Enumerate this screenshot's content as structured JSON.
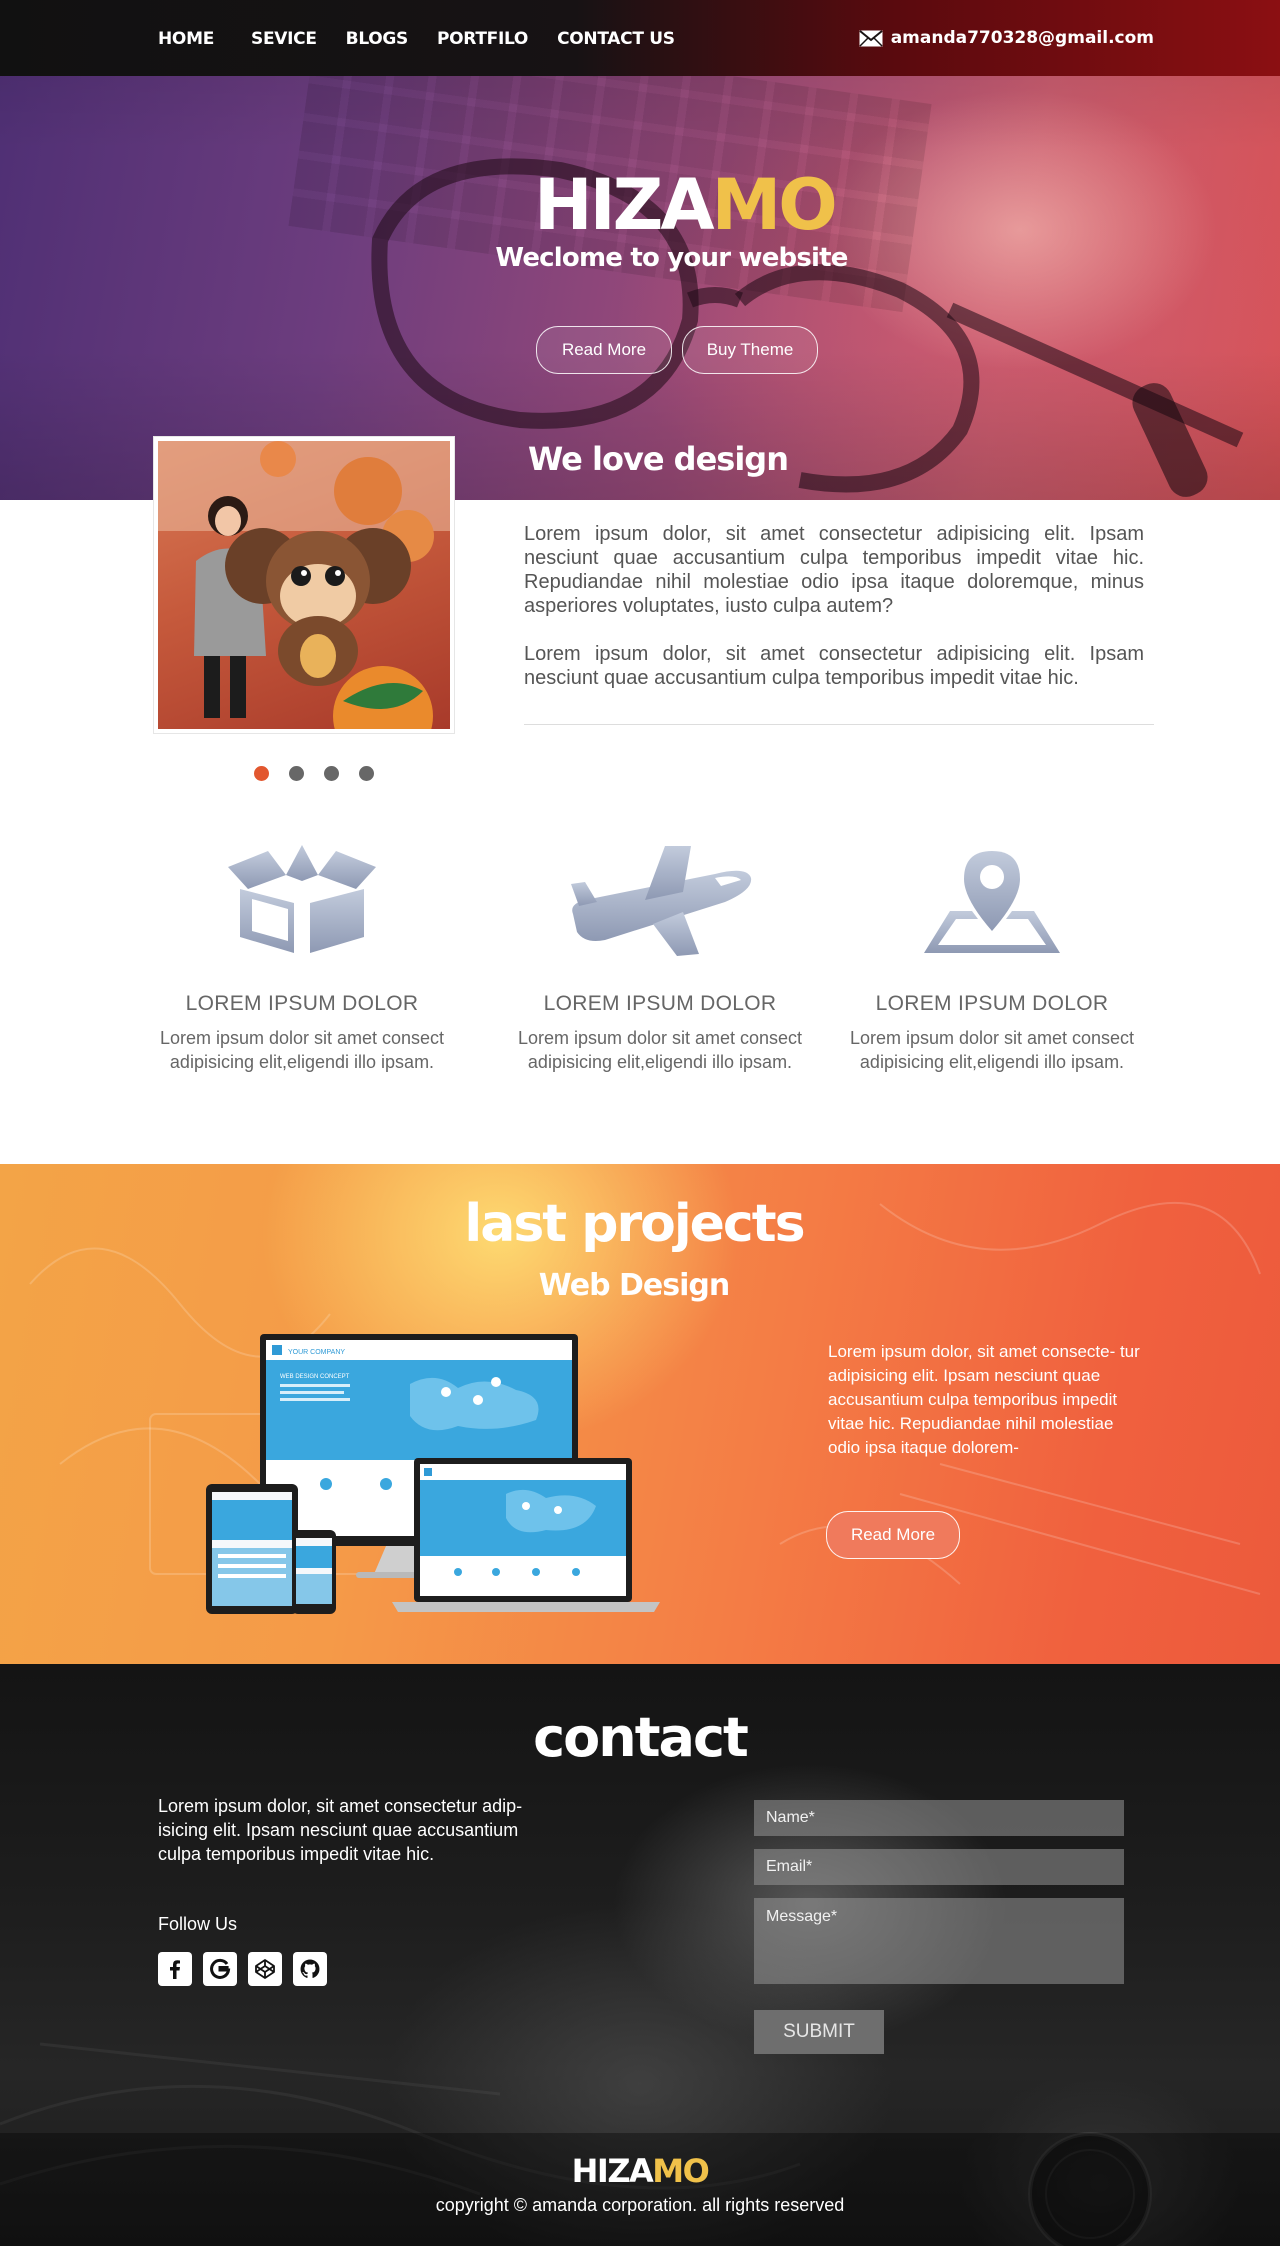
{
  "colors": {
    "accent_yellow": "#f0c14a",
    "slider_active": "#e2572f",
    "slider_dot": "#676767",
    "feature_icon": "#a3afc9",
    "projects_orange": "#f47c45"
  },
  "nav": {
    "items": [
      "HOME",
      "SEVICE",
      "BLOGS",
      "PORTFILO",
      "CONTACT US"
    ],
    "email": "amanda770328@gmail.com",
    "email_icon": "envelope-icon"
  },
  "hero": {
    "logo_main": "HIZA",
    "logo_accent": "MO",
    "tagline": "Weclome to your website",
    "read_more": "Read More",
    "buy_theme": "Buy Theme"
  },
  "about": {
    "title": "We love design",
    "paragraph_1": "Lorem ipsum dolor, sit amet consectetur adipisicing elit. Ipsam nesciunt quae accusantium culpa temporibus impedit vitae hic. Repudiandae nihil molestiae odio ipsa itaque doloremque, minus asperiores voluptates, iusto culpa autem?",
    "paragraph_2": "Lorem ipsum dolor, sit amet consectetur adipisicing elit. Ipsam nesciunt quae accusantium culpa temporibus impedit vitae hic.",
    "slider_dots": 4,
    "slider_active_index": 0
  },
  "features": [
    {
      "icon": "box-icon",
      "title": "LOREM IPSUM DOLOR",
      "text": "Lorem ipsum dolor sit amet consect adipisicing elit,eligendi illo ipsam."
    },
    {
      "icon": "airplane-icon",
      "title": "LOREM IPSUM DOLOR",
      "text": "Lorem ipsum dolor sit amet consect adipisicing elit,eligendi illo ipsam."
    },
    {
      "icon": "map-pin-icon",
      "title": "LOREM IPSUM DOLOR",
      "text": "Lorem ipsum dolor sit amet consect adipisicing elit,eligendi illo ipsam."
    }
  ],
  "projects": {
    "title": "last projects",
    "subtitle": "Web Design",
    "text": "Lorem ipsum dolor, sit amet consecte- tur adipisicing elit. Ipsam nesciunt quae accusantium culpa temporibus impedit vitae hic. Repudiandae nihil molestiae odio ipsa itaque dolorem-",
    "read_more": "Read More",
    "mockup_brand": "YOUR COMPANY",
    "mockup_heading": "WEB DESIGN CONCEPT"
  },
  "contact": {
    "title": "contact",
    "text": "Lorem ipsum dolor, sit amet consectetur adip- isicing elit. Ipsam nesciunt quae accusantium culpa temporibus impedit vitae hic.",
    "follow_label": "Follow Us",
    "socials": [
      "facebook-icon",
      "google-icon",
      "codepen-icon",
      "github-icon"
    ],
    "name_placeholder": "Name*",
    "email_placeholder": "Email*",
    "message_placeholder": "Message*",
    "submit_label": "SUBMIT"
  },
  "footer": {
    "logo_main": "HIZA",
    "logo_accent": "MO",
    "copyright": "copyright © amanda corporation. all rights reserved"
  }
}
